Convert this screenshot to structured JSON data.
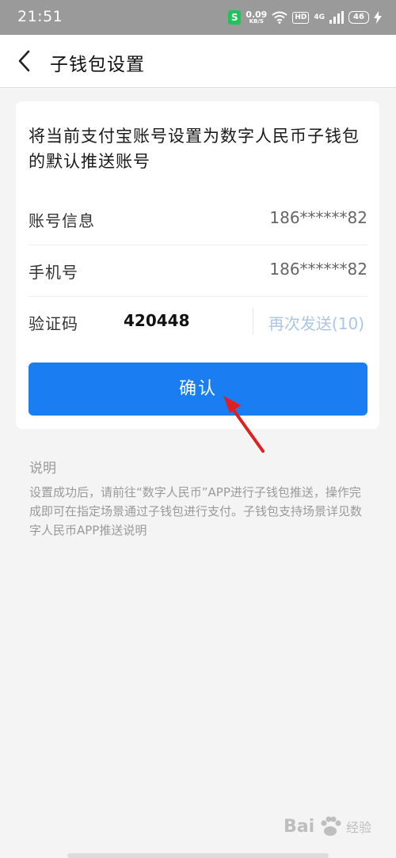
{
  "status_bar": {
    "time": "21:51",
    "security_icon": "S",
    "speed_value": "0.09",
    "speed_unit": "KB/S",
    "hd_label": "HD",
    "network_label": "4G",
    "battery": "46"
  },
  "header": {
    "back_icon": "chevron-left",
    "title": "子钱包设置"
  },
  "card": {
    "description": "将当前支付宝账号设置为数字人民币子钱包的默认推送账号",
    "rows": [
      {
        "label": "账号信息",
        "value": "186******82"
      },
      {
        "label": "手机号",
        "value": "186******82"
      }
    ],
    "code_row": {
      "label": "验证码",
      "value": "420448",
      "resend_label": "再次发送(10)"
    },
    "confirm_label": "确认"
  },
  "notes": {
    "title": "说明",
    "text": "设置成功后，请前往“数字人民币”APP进行子钱包推送，操作完成即可在指定场景通过子钱包进行支付。子钱包支持场景详见数字人民币APP推送说明"
  },
  "watermark": {
    "brand": "Bai",
    "sub": "经验"
  },
  "colors": {
    "accent": "#1a7ef2",
    "resend": "#a9c6e6",
    "arrow": "#e02020",
    "status_bar": "#9a9a9a"
  }
}
